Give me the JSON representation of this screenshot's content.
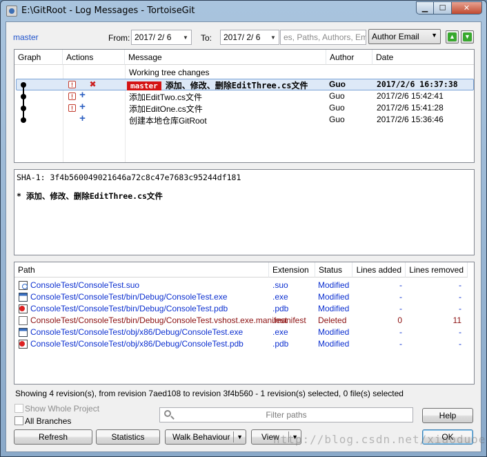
{
  "window": {
    "title": "E:\\GitRoot - Log Messages - TortoiseGit"
  },
  "filter": {
    "branch": "master",
    "from_label": "From:",
    "from_date": "2017/ 2/ 6",
    "to_label": "To:",
    "to_date": "2017/ 2/ 6",
    "search_placeholder": "es, Paths, Authors, Email",
    "search_field": "Author Email"
  },
  "log": {
    "columns": {
      "graph": "Graph",
      "actions": "Actions",
      "message": "Message",
      "author": "Author",
      "date": "Date"
    },
    "working_tree": "Working tree changes",
    "rows": [
      {
        "branch_tag": "master",
        "message": "添加、修改、删除EditThree.cs文件",
        "author": "Guo",
        "date": "2017/2/6 16:37:38"
      },
      {
        "branch_tag": "",
        "message": "添加EditTwo.cs文件",
        "author": "Guo",
        "date": "2017/2/6 15:42:41"
      },
      {
        "branch_tag": "",
        "message": "添加EditOne.cs文件",
        "author": "Guo",
        "date": "2017/2/6 15:41:28"
      },
      {
        "branch_tag": "",
        "message": "创建本地仓库GitRoot",
        "author": "Guo",
        "date": "2017/2/6 15:36:46"
      }
    ]
  },
  "detail": {
    "sha_line": "SHA-1: 3f4b560049021646a72c8c47e7683c95244df181",
    "message_line": "* 添加、修改、删除EditThree.cs文件"
  },
  "files": {
    "columns": {
      "path": "Path",
      "extension": "Extension",
      "status": "Status",
      "added": "Lines added",
      "removed": "Lines removed"
    },
    "rows": [
      {
        "icon": "suo-file-icon",
        "path": "ConsoleTest/ConsoleTest.suo",
        "ext": ".suo",
        "status": "Modified",
        "added": "-",
        "removed": "-"
      },
      {
        "icon": "exe-file-icon",
        "path": "ConsoleTest/ConsoleTest/bin/Debug/ConsoleTest.exe",
        "ext": ".exe",
        "status": "Modified",
        "added": "-",
        "removed": "-"
      },
      {
        "icon": "pdb-file-icon",
        "path": "ConsoleTest/ConsoleTest/bin/Debug/ConsoleTest.pdb",
        "ext": ".pdb",
        "status": "Modified",
        "added": "-",
        "removed": "-"
      },
      {
        "icon": "document-file-icon",
        "path": "ConsoleTest/ConsoleTest/bin/Debug/ConsoleTest.vshost.exe.manifest",
        "ext": ".manifest",
        "status": "Deleted",
        "added": "0",
        "removed": "11"
      },
      {
        "icon": "exe-file-icon",
        "path": "ConsoleTest/ConsoleTest/obj/x86/Debug/ConsoleTest.exe",
        "ext": ".exe",
        "status": "Modified",
        "added": "-",
        "removed": "-"
      },
      {
        "icon": "pdb-file-icon",
        "path": "ConsoleTest/ConsoleTest/obj/x86/Debug/ConsoleTest.pdb",
        "ext": ".pdb",
        "status": "Modified",
        "added": "-",
        "removed": "-"
      }
    ]
  },
  "status_text": "Showing 4 revision(s), from revision 7aed108 to revision 3f4b560 - 1 revision(s) selected, 0 file(s) selected",
  "options": {
    "whole_project": "Show Whole Project",
    "all_branches": "All Branches"
  },
  "filter_paths_placeholder": "Filter paths",
  "buttons": {
    "help": "Help",
    "refresh": "Refresh",
    "statistics": "Statistics",
    "walk_behaviour": "Walk Behaviour",
    "view": "View",
    "ok": "OK"
  },
  "watermark": "http://blog.csdn.net/xiaoduoe",
  "colors": {
    "branch_tag_bg": "#d41414",
    "modified_text": "#0b2fd0",
    "deleted_text": "#8b0f0f",
    "selection": "#dde9f7"
  }
}
